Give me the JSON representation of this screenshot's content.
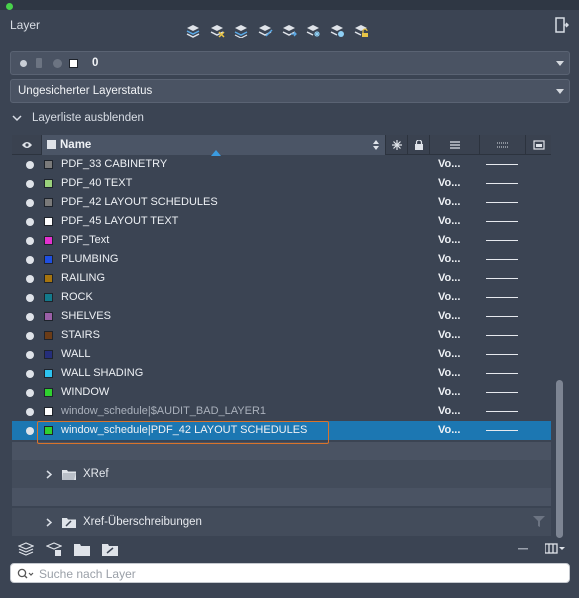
{
  "panel": {
    "title": "Layer"
  },
  "toolbar": {
    "icons": [
      "new-layer-icon",
      "delete-layer-icon",
      "set-current-icon",
      "merge-layers-icon",
      "isolate-icon",
      "freeze-icon",
      "lock-icon",
      "unlock-icon"
    ]
  },
  "current_layer": {
    "value": "0",
    "color": "#ffffff"
  },
  "layer_state": {
    "value": "Ungesicherter Layerstatus"
  },
  "toggle": {
    "label": "Layerliste ausblenden"
  },
  "table": {
    "header": {
      "name": "Name"
    },
    "rows": [
      {
        "name": "PDF_33 CABINETRY",
        "color": "#7a7a7a",
        "value": "Vo...",
        "dim": false,
        "selected": false
      },
      {
        "name": "PDF_40 TEXT",
        "color": "#9ad17c",
        "value": "Vo...",
        "dim": false,
        "selected": false
      },
      {
        "name": "PDF_42 LAYOUT SCHEDULES",
        "color": "#7a7a7a",
        "value": "Vo...",
        "dim": false,
        "selected": false
      },
      {
        "name": "PDF_45 LAYOUT TEXT",
        "color": "#ffffff",
        "value": "Vo...",
        "dim": false,
        "selected": false
      },
      {
        "name": "PDF_Text",
        "color": "#e331d0",
        "value": "Vo...",
        "dim": false,
        "selected": false
      },
      {
        "name": "PLUMBING",
        "color": "#1f4fe0",
        "value": "Vo...",
        "dim": false,
        "selected": false
      },
      {
        "name": "RAILING",
        "color": "#a5740e",
        "value": "Vo...",
        "dim": false,
        "selected": false
      },
      {
        "name": "ROCK",
        "color": "#137a8c",
        "value": "Vo...",
        "dim": false,
        "selected": false
      },
      {
        "name": "SHELVES",
        "color": "#9a5fa7",
        "value": "Vo...",
        "dim": false,
        "selected": false
      },
      {
        "name": "STAIRS",
        "color": "#6b3c17",
        "value": "Vo...",
        "dim": false,
        "selected": false
      },
      {
        "name": "WALL",
        "color": "#252e7a",
        "value": "Vo...",
        "dim": false,
        "selected": false
      },
      {
        "name": "WALL SHADING",
        "color": "#2dc3f0",
        "value": "Vo...",
        "dim": false,
        "selected": false
      },
      {
        "name": "WINDOW",
        "color": "#2fd12f",
        "value": "Vo...",
        "dim": false,
        "selected": false
      },
      {
        "name": "window_schedule|$AUDIT_BAD_LAYER1",
        "color": "#ffffff",
        "value": "Vo...",
        "dim": true,
        "selected": false
      },
      {
        "name": "window_schedule|PDF_42 LAYOUT SCHEDULES",
        "color": "#2fd12f",
        "value": "Vo...",
        "dim": false,
        "selected": true
      }
    ]
  },
  "groups": {
    "xref": "XRef",
    "overrides": "Xref-Überschreibungen"
  },
  "search": {
    "placeholder": "Suche nach Layer"
  }
}
